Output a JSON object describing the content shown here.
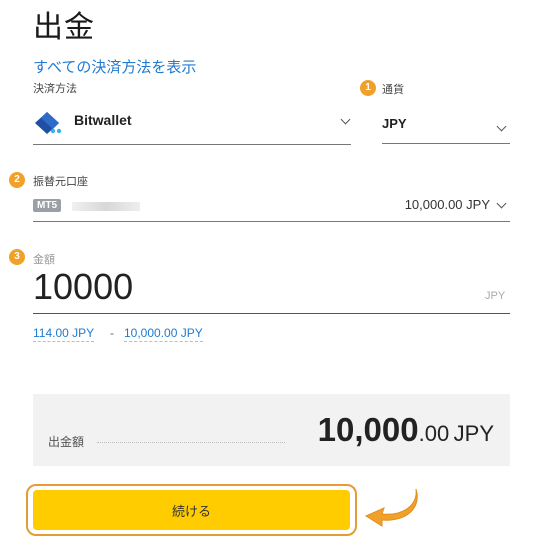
{
  "page": {
    "title": "出金"
  },
  "links": {
    "show_all_methods": "すべての決済方法を表示"
  },
  "payment_method": {
    "label": "決済方法",
    "value": "Bitwallet",
    "icon": "bitwallet-logo"
  },
  "currency": {
    "step": "1",
    "label": "通貨",
    "value": "JPY"
  },
  "source_account": {
    "step": "2",
    "label": "振替元口座",
    "platform_badge": "MT5",
    "balance": "10,000.00 JPY"
  },
  "amount": {
    "step": "3",
    "label": "金額",
    "value": "10000",
    "unit": "JPY",
    "min": "114.00 JPY",
    "separator": "-",
    "max": "10,000.00 JPY"
  },
  "summary": {
    "label": "出金額",
    "amount_main": "10,000",
    "amount_decimal": ".00",
    "currency": "JPY"
  },
  "cta": {
    "label": "続ける"
  },
  "colors": {
    "accent": "#ffcc00",
    "link": "#1f7ad1",
    "step": "#f0a12a",
    "highlight": "#e59b37"
  }
}
